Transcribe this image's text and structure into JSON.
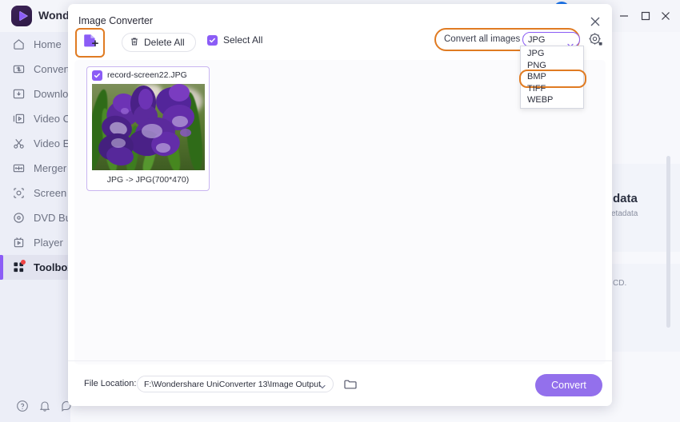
{
  "app": {
    "name": "Wondershare UniConverter",
    "name_visible": "Wonder",
    "logo_icon": "wondershare-logo-icon",
    "avatar_icon": "user-avatar-icon",
    "top_icon": "window-icon",
    "window_controls": {
      "minimize": "minimize-icon",
      "maximize": "maximize-icon",
      "close": "close-icon"
    }
  },
  "sidebar": {
    "items": [
      {
        "label": "Home",
        "icon": "home-icon",
        "active": false
      },
      {
        "label": "Converter",
        "icon": "converter-icon",
        "active": false
      },
      {
        "label": "Downloader",
        "icon": "download-icon",
        "active": false
      },
      {
        "label": "Video Compressor",
        "icon": "video-compress-icon",
        "active": false
      },
      {
        "label": "Video Editor",
        "icon": "scissors-icon",
        "active": false
      },
      {
        "label": "Merger",
        "icon": "merger-icon",
        "active": false
      },
      {
        "label": "Screen Recorder",
        "icon": "screen-record-icon",
        "active": false
      },
      {
        "label": "DVD Burner",
        "icon": "dvd-icon",
        "active": false
      },
      {
        "label": "Player",
        "icon": "player-icon",
        "active": false
      },
      {
        "label": "Toolbox",
        "icon": "toolbox-icon",
        "active": true,
        "badge": true
      }
    ],
    "footer_icons": [
      "help-icon",
      "bell-icon",
      "feedback-icon"
    ]
  },
  "background": {
    "card_title": "data",
    "card_sub": "etadata",
    "card_sub2": "CD.",
    "scrollbar": "vertical-scrollbar"
  },
  "dialog": {
    "title": "Image Converter",
    "close_icon": "close-icon",
    "toolbar": {
      "add_files_icon": "add-file-icon",
      "delete_all_label": "Delete All",
      "delete_icon": "trash-icon",
      "select_all_label": "Select All",
      "select_all_checked": true
    },
    "convert_to": {
      "label": "Convert all images to:",
      "selected": "JPG",
      "caret_icon": "chevron-down-icon",
      "settings_icon": "gear-icon",
      "options": [
        "JPG",
        "PNG",
        "BMP",
        "TIFF",
        "WEBP"
      ],
      "highlighted_option": "BMP"
    },
    "files": [
      {
        "name": "record-screen22.JPG",
        "checked": true,
        "caption": "JPG -> JPG(700*470)",
        "thumbnail": "purple-iris-flowers-photo"
      }
    ],
    "footer": {
      "file_location_label": "File Location:",
      "file_location_value": "F:\\Wondershare UniConverter 13\\Image Output",
      "file_location_caret": "chevron-down-icon",
      "folder_icon": "folder-icon",
      "convert_label": "Convert"
    }
  },
  "colors": {
    "accent_purple": "#8b5cf6",
    "convert_button": "#9370ec",
    "highlight_orange": "#e07b22",
    "sidebar_bg": "#eceef7",
    "badge_red": "#ef4444"
  }
}
